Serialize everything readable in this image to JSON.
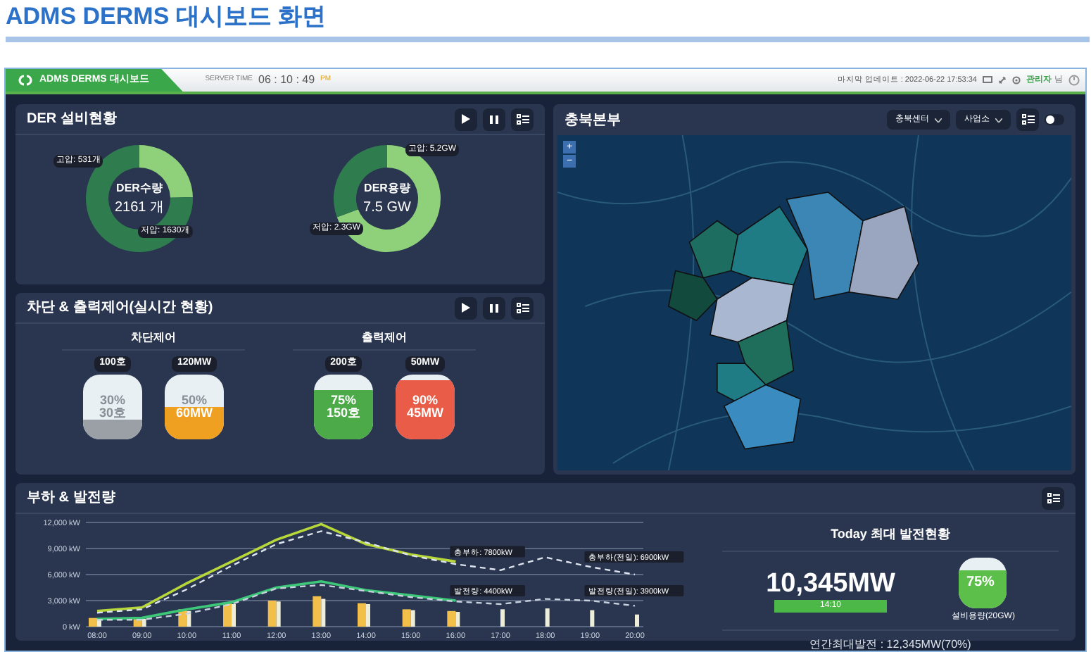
{
  "page_title": "ADMS DERMS 대시보드 화면",
  "app": {
    "tab": "ADMS DERMS 대시보드",
    "server_time_label": "SERVER TIME",
    "server_time": "06 : 10 : 49",
    "server_time_ampm": "PM",
    "last_update": "마지막 업데이트 : 2022-06-22 17:53:34",
    "user": "관리자",
    "user_suffix": "님"
  },
  "der_panel": {
    "title": "DER 설비현황",
    "donuts": [
      {
        "chart_data": {
          "type": "donut",
          "categories": [
            "고압: 531개",
            "저압: 1630개"
          ],
          "values": [
            531,
            1630
          ]
        },
        "center_label": "DER수량",
        "center_value": "2161 개"
      },
      {
        "chart_data": {
          "type": "donut",
          "categories": [
            "고압: 5.2GW",
            "저압: 2.3GW"
          ],
          "values": [
            5.2,
            2.3
          ]
        },
        "center_label": "DER용량",
        "center_value": "7.5 GW"
      }
    ]
  },
  "control_panel": {
    "title": "차단 & 출력제어(실시간 현황)",
    "groups": [
      {
        "title": "차단제어",
        "tanks": [
          {
            "top_label": "100호",
            "level": 0.3,
            "color": "#9aa0a6",
            "percent": "30%",
            "value": "30호"
          },
          {
            "top_label": "120MW",
            "level": 0.5,
            "color": "#f0a020",
            "percent": "50%",
            "value": "60MW"
          }
        ]
      },
      {
        "title": "출력제어",
        "tanks": [
          {
            "top_label": "200호",
            "level": 0.75,
            "color": "#4caa48",
            "percent": "75%",
            "value": "150호"
          },
          {
            "top_label": "50MW",
            "level": 0.9,
            "color": "#e85c48",
            "percent": "90%",
            "value": "45MW"
          }
        ]
      }
    ]
  },
  "map_panel": {
    "title": "충북본부",
    "dropdowns": [
      "충북센터",
      "사업소"
    ],
    "toggle_on": false,
    "zoom_in": "+",
    "zoom_out": "−"
  },
  "load_panel": {
    "title": "부하 & 발전량",
    "chart_data": {
      "type": "bar",
      "stacked": false,
      "grid": true,
      "categories": [
        "08:00",
        "09:00",
        "10:00",
        "11:00",
        "12:00",
        "13:00",
        "14:00",
        "15:00",
        "16:00",
        "17:00",
        "18:00",
        "19:00",
        "20:00"
      ],
      "yticks": [
        {
          "value": 0,
          "label": "0 kW"
        },
        {
          "value": 3000,
          "label": "3,000 kW"
        },
        {
          "value": 6000,
          "label": "6,000 kW"
        },
        {
          "value": 9000,
          "label": "9,000 kW"
        },
        {
          "value": 12000,
          "label": "12,000 kW"
        }
      ],
      "ylim": [
        0,
        12000
      ],
      "series": [
        {
          "color": "#f2c04a",
          "values": [
            1000,
            900,
            2000,
            2800,
            3000,
            3500,
            2700,
            2000,
            1800,
            null,
            null,
            null,
            null
          ]
        },
        {
          "color": "#eeeed8",
          "values": [
            900,
            900,
            1800,
            2600,
            2900,
            3200,
            2600,
            1900,
            1700,
            2000,
            2100,
            1900,
            1400
          ]
        },
        {
          "type": "line",
          "color": "#b8d83a",
          "values": [
            1800,
            2200,
            5000,
            7500,
            10000,
            11800,
            9500,
            8300,
            7500,
            null,
            null,
            null,
            null
          ]
        },
        {
          "type": "line",
          "line_style": "dashed",
          "color": "#dde4ee",
          "values": [
            1600,
            2000,
            4300,
            7000,
            9500,
            11000,
            9700,
            8200,
            7200,
            6500,
            8000,
            6900,
            6000
          ]
        },
        {
          "type": "line",
          "color": "#3cc878",
          "values": [
            900,
            1000,
            2000,
            2800,
            4500,
            5200,
            4200,
            3600,
            3000,
            null,
            null,
            null,
            null
          ]
        },
        {
          "type": "line",
          "line_style": "dashed",
          "color": "#c8d2de",
          "values": [
            800,
            800,
            1500,
            2600,
            4400,
            4800,
            4100,
            3400,
            2900,
            2600,
            3200,
            3000,
            2400
          ]
        }
      ],
      "annotations": [
        "총부하: 7800kW",
        "총부하(전일): 6900kW",
        "발전량: 4400kW",
        "발전량(전일): 3900kW"
      ]
    },
    "today": {
      "title": "Today 최대 발전현황",
      "max_value": "10,345MW",
      "max_time": "14:10",
      "capacity": {
        "level": 0.75,
        "percent": "75%",
        "label": "설비용량(20GW)"
      },
      "annual": "연간최대발전 : 12,345MW(70%)"
    }
  }
}
